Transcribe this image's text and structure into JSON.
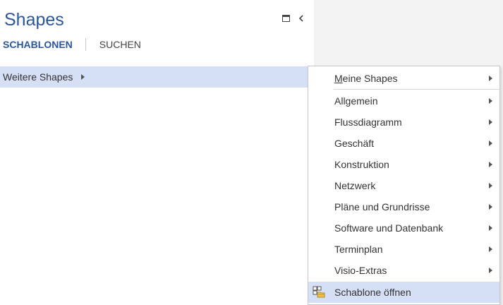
{
  "pane": {
    "title": "Shapes",
    "tabs": [
      {
        "label": "SCHABLONEN",
        "active": true
      },
      {
        "label": "SUCHEN",
        "active": false
      }
    ],
    "icons": {
      "maximize": "maximize-icon",
      "collapse": "chevron-left-icon"
    }
  },
  "more_shapes": {
    "label": "Weitere Shapes",
    "icon": "chevron-right-icon"
  },
  "menu": {
    "my_shapes": "Meine Shapes",
    "items": [
      "Allgemein",
      "Flussdiagramm",
      "Geschäft",
      "Konstruktion",
      "Netzwerk",
      "Pläne und Grundrisse",
      "Software und Datenbank",
      "Terminplan",
      "Visio-Extras"
    ],
    "open_stencil": {
      "label": "Schablone öffnen",
      "icon": "open-stencil-icon"
    }
  },
  "colors": {
    "accent": "#2b579a",
    "highlight": "#d5dff5"
  }
}
